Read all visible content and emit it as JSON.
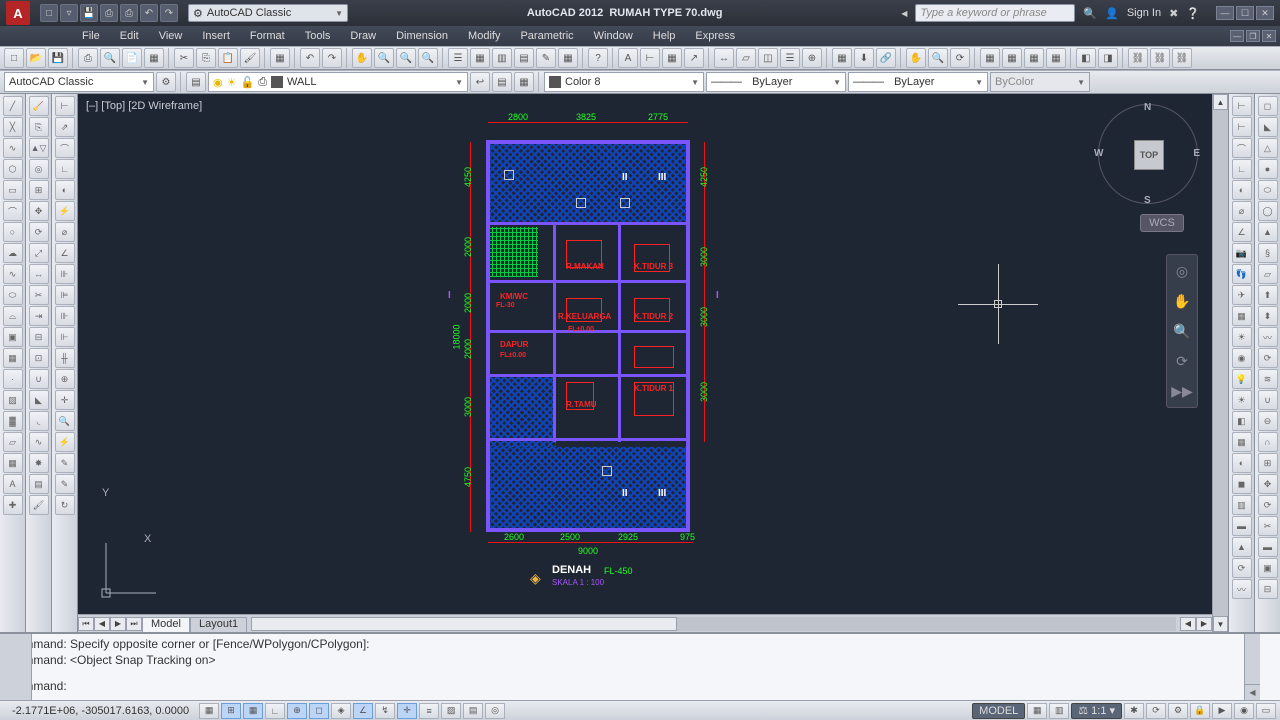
{
  "title": {
    "app": "AutoCAD 2012",
    "file": "RUMAH TYPE 70.dwg"
  },
  "workspace_dropdown": "AutoCAD Classic",
  "search": {
    "placeholder": "Type a keyword or phrase"
  },
  "signin": "Sign In",
  "menus": [
    "File",
    "Edit",
    "View",
    "Insert",
    "Format",
    "Tools",
    "Draw",
    "Dimension",
    "Modify",
    "Parametric",
    "Window",
    "Help",
    "Express"
  ],
  "props": {
    "workspace": "AutoCAD Classic",
    "layer": "WALL",
    "color": "Color 8",
    "color_hex": "#555555",
    "linetype": "ByLayer",
    "lineweight": "ByLayer",
    "plotstyle": "ByColor"
  },
  "view_label": "[–] [Top] [2D Wireframe]",
  "viewcube": {
    "face": "TOP",
    "n": "N",
    "s": "S",
    "e": "E",
    "w": "W",
    "wcs": "WCS"
  },
  "floorplan": {
    "title": "DENAH",
    "subtitle": "SKALA 1 : 100",
    "note": "FL-450",
    "dims_top": [
      "2800",
      "3825",
      "2775"
    ],
    "dims_bottom": [
      "2600",
      "2500",
      "2925",
      "975"
    ],
    "dim_bottom_total": "9000",
    "dims_left": [
      "4250",
      "2000",
      "2000",
      "2000",
      "3000",
      "4750"
    ],
    "dim_left_total": "18000",
    "dims_right": [
      "4250",
      "3000",
      "3000",
      "3000"
    ],
    "rooms": [
      "R.MAKAN",
      "K.TIDUR 3",
      "KM/WC",
      "R.KELUARGA",
      "K.TIDUR 2",
      "DAPUR",
      "K.TIDUR 1",
      "R.TAMU"
    ],
    "room_notes": [
      "FL-30",
      "FL±0.00",
      "FL±0.00"
    ],
    "sections": {
      "I_left": "I",
      "I_right": "I",
      "II_top": "II",
      "III_top": "III",
      "II_bot": "II",
      "III_bot": "III"
    }
  },
  "tabs": {
    "model": "Model",
    "layout": "Layout1"
  },
  "command": {
    "line1": "Command: Specify opposite corner or [Fence/WPolygon/CPolygon]:",
    "line2": "Command:  <Object Snap Tracking on>",
    "line3": "Command:"
  },
  "status": {
    "coords": "-2.1771E+06, -305017.6163, 0.0000",
    "model_btn": "MODEL",
    "scale": "1:1"
  }
}
